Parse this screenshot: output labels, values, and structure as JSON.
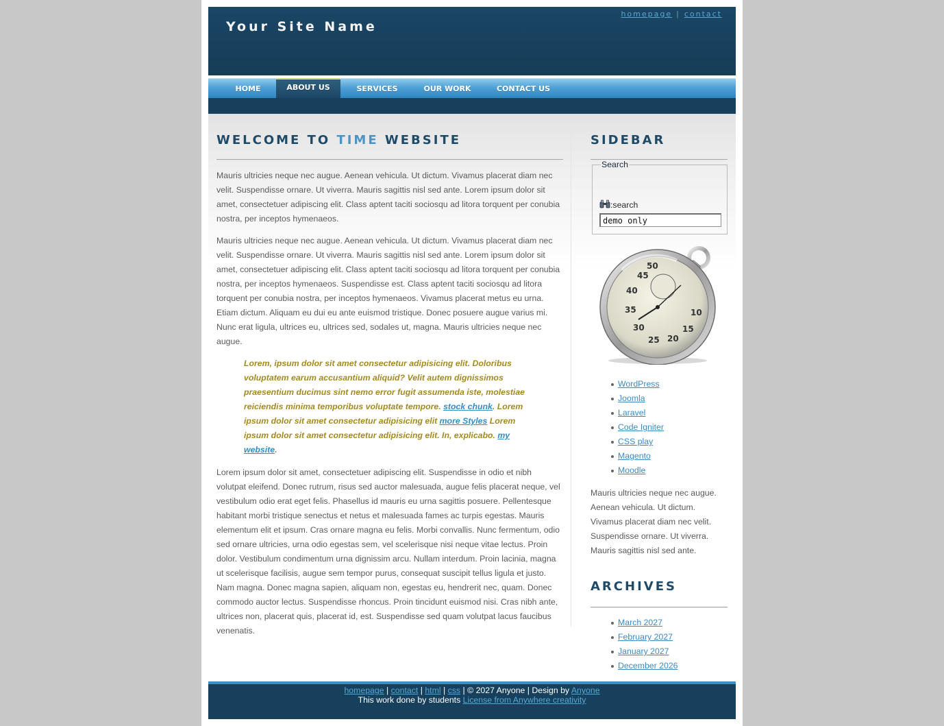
{
  "header": {
    "site_name": "Your Site Name",
    "links": [
      "homepage",
      "contact"
    ],
    "separator": "|"
  },
  "nav": {
    "items": [
      "HOME",
      "ABOUT US",
      "SERVICES",
      "OUR WORK",
      "CONTACT US"
    ],
    "active": "ABOUT US"
  },
  "main": {
    "title_pre": "WELCOME TO ",
    "title_highlight": "TIME",
    "title_post": " WEBSITE",
    "para1": "Mauris ultricies neque nec augue. Aenean vehicula. Ut dictum. Vivamus placerat diam nec velit. Suspendisse ornare. Ut viverra. Mauris sagittis nisl sed ante. Lorem ipsum dolor sit amet, consectetuer adipiscing elit. Class aptent taciti sociosqu ad litora torquent per conubia nostra, per inceptos hymenaeos.",
    "para2": "Mauris ultricies neque nec augue. Aenean vehicula. Ut dictum. Vivamus placerat diam nec velit. Suspendisse ornare. Ut viverra. Mauris sagittis nisl sed ante. Lorem ipsum dolor sit amet, consectetuer adipiscing elit. Class aptent taciti sociosqu ad litora torquent per conubia nostra, per inceptos hymenaeos. Suspendisse est. Class aptent taciti sociosqu ad litora torquent per conubia nostra, per inceptos hymenaeos. Vivamus placerat metus eu urna. Etiam dictum. Aliquam eu dui eu ante euismod tristique. Donec posuere augue varius mi. Nunc erat ligula, ultrices eu, ultrices sed, sodales ut, magna. Mauris ultricies neque nec augue.",
    "quote": {
      "text1": "Lorem, ipsum dolor sit amet consectetur adipisicing elit. Doloribus voluptatem earum accusantium aliquid? Velit autem dignissimos praesentium ducimus sint nemo error fugit assumenda iste, molestiae reiciendis minima temporibus voluptate tempore. ",
      "link1": "stock chunk",
      "text2": ". Lorem ipsum dolor sit amet consectetur adipisicing elit ",
      "link2": "more Styles",
      "text3": " Lorem ipsum dolor sit amet consectetur adipisicing elit. In, explicabo. ",
      "link3": "my website",
      "text4": "."
    },
    "para3": "Lorem ipsum dolor sit amet, consectetuer adipiscing elit. Suspendisse in odio et nibh volutpat eleifend. Donec rutrum, risus sed auctor malesuada, augue felis placerat neque, vel vestibulum odio erat eget felis. Phasellus id mauris eu urna sagittis posuere. Pellentesque habitant morbi tristique senectus et netus et malesuada fames ac turpis egestas. Mauris elementum elit et ipsum. Cras ornare magna eu felis. Morbi convallis. Nunc fermentum, odio sed ornare ultricies, urna odio egestas sem, vel scelerisque nisi neque vitae lectus. Proin dolor. Vestibulum condimentum urna dignissim arcu. Nullam interdum. Proin lacinia, magna ut scelerisque facilisis, augue sem tempor purus, consequat suscipit tellus ligula et justo. Nam magna. Donec magna sapien, aliquam non, egestas eu, hendrerit nec, quam. Donec commodo auctor lectus. Suspendisse rhoncus. Proin tincidunt euismod nisi. Cras nibh ante, ultrices non, placerat quis, placerat id, est. Suspendisse sed quam volutpat lacus faucibus venenatis."
  },
  "sidebar": {
    "title": "SIDEBAR",
    "search_legend": "Search",
    "search_label": ":search",
    "search_value": "demo only",
    "links": [
      "WordPress",
      "Joomla",
      "Laravel",
      "Code Igniter",
      "CSS play",
      "Magento",
      "Moodle"
    ],
    "text": "Mauris ultricies neque nec augue. Aenean vehicula. Ut dictum. Vivamus placerat diam nec velit. Suspendisse ornare. Ut viverra. Mauris sagittis nisl sed ante.",
    "archives_title": "ARCHIVES",
    "archives": [
      "March 2027",
      "February 2027",
      "January 2027",
      "December 2026"
    ]
  },
  "footer": {
    "links": [
      "homepage",
      "contact",
      "html",
      "css"
    ],
    "separator": "|",
    "copyright": "| © 2027 Anyone | Design by ",
    "designer": "Anyone",
    "line2_text": "This work done by students ",
    "line2_link": "License from Anywhere creativity"
  },
  "colors": {
    "header_bg": "#17405c",
    "accent": "#4b95c6",
    "quote": "#a48a1f",
    "link": "#3a8bc2"
  },
  "icons": [
    "binoculars-icon",
    "stopwatch-image"
  ]
}
